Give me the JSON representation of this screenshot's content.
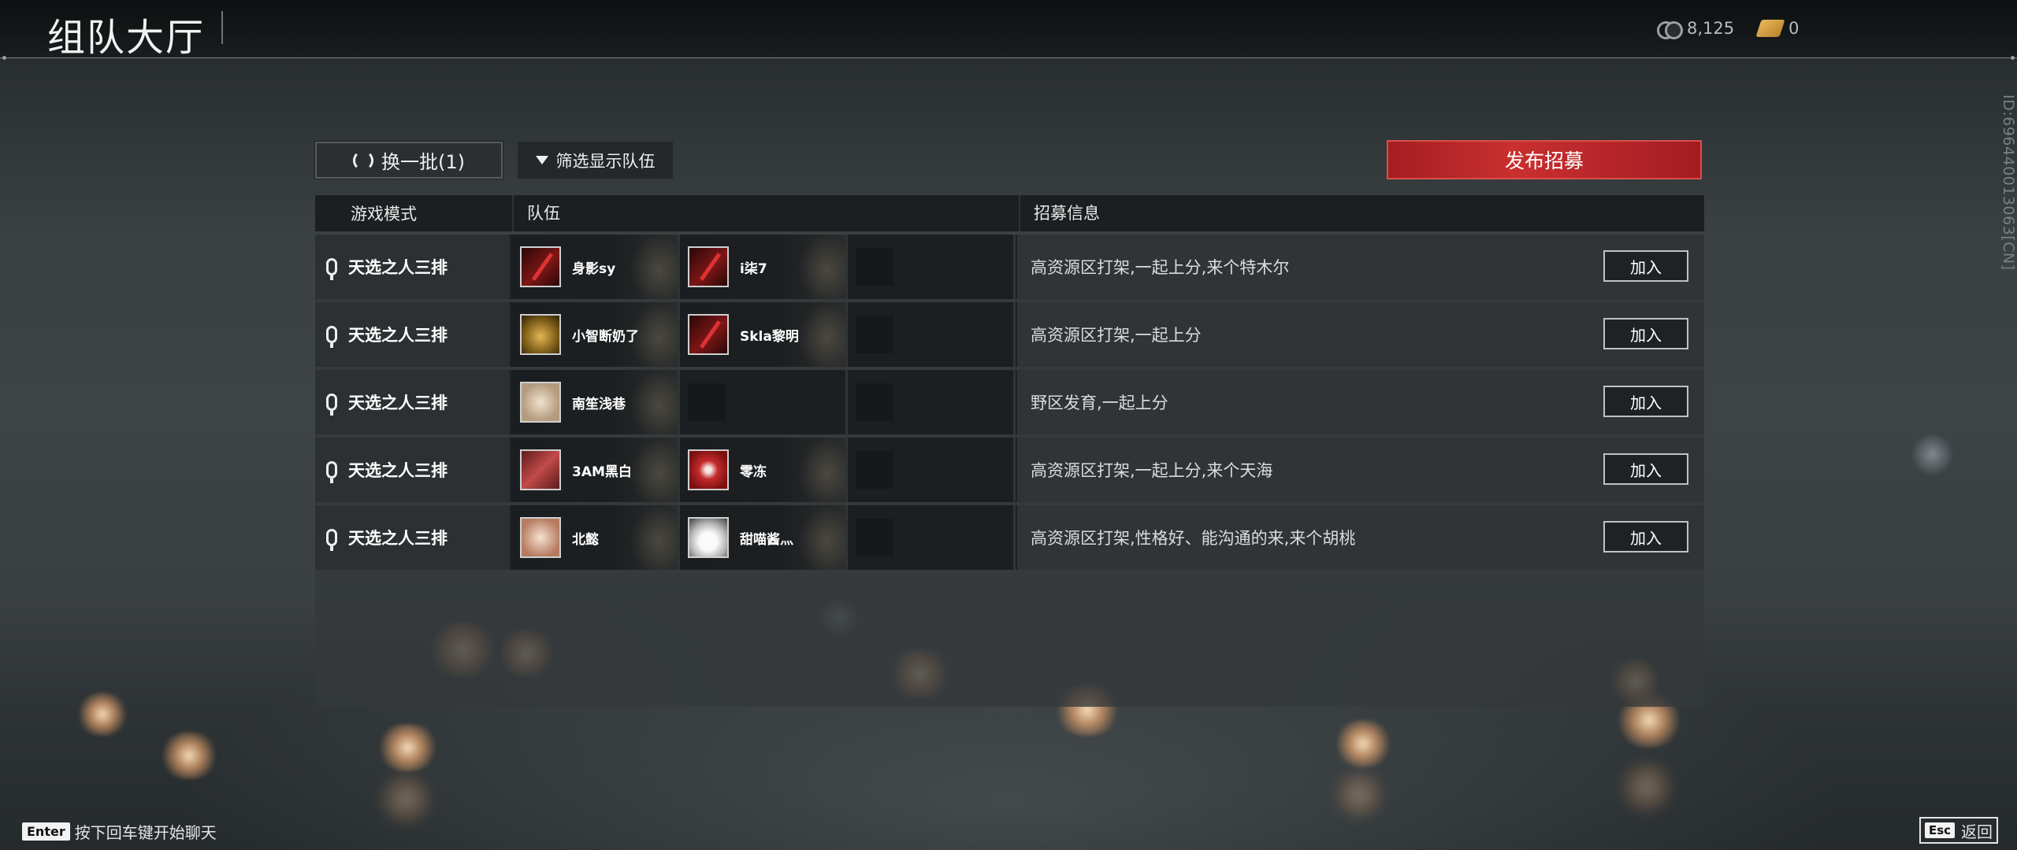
{
  "header": {
    "title": "组队大厅",
    "currencies": [
      {
        "icon": "coin-icon",
        "value": "8,125"
      },
      {
        "icon": "ticket-icon",
        "value": "0"
      }
    ]
  },
  "user_id_text": "ID:696440013063[CN]",
  "controls": {
    "refresh_label": "换一批(1)",
    "filter_label": "筛选显示队伍",
    "post_label": "发布招募"
  },
  "table": {
    "headers": {
      "mode": "游戏模式",
      "team": "队伍",
      "info": "招募信息"
    },
    "join_label": "加入",
    "rows": [
      {
        "mode": "天选之人三排",
        "members": [
          {
            "name": "身影sy",
            "avatar": "red-blade-avatar"
          },
          {
            "name": "i柒7",
            "avatar": "red-blade-avatar"
          }
        ],
        "info": "高资源区打架,一起上分,来个特木尔"
      },
      {
        "mode": "天选之人三排",
        "members": [
          {
            "name": "小智断奶了",
            "avatar": "golden-tiger-avatar"
          },
          {
            "name": "Skla黎明",
            "avatar": "red-blade-avatar"
          }
        ],
        "info": "高资源区打架,一起上分"
      },
      {
        "mode": "天选之人三排",
        "members": [
          {
            "name": "南笙浅巷",
            "avatar": "beige-dragon-avatar"
          }
        ],
        "info": "野区发育,一起上分"
      },
      {
        "mode": "天选之人三排",
        "members": [
          {
            "name": "3AM黑白",
            "avatar": "bamboo-avatar"
          },
          {
            "name": "零冻",
            "avatar": "crimson-emblem-avatar"
          }
        ],
        "info": "高资源区打架,一起上分,来个天海"
      },
      {
        "mode": "天选之人三排",
        "members": [
          {
            "name": "北懿",
            "avatar": "crane-avatar"
          },
          {
            "name": "甜喵酱灬",
            "avatar": "white-mask-avatar"
          }
        ],
        "info": "高资源区打架,性格好、能沟通的来,来个胡桃"
      }
    ]
  },
  "footer": {
    "chat_key": "Enter",
    "chat_hint": "按下回车键开始聊天",
    "back_key": "Esc",
    "back_label": "返回"
  },
  "colors": {
    "accent_red": "#c9302e",
    "background": "#3b4143"
  }
}
